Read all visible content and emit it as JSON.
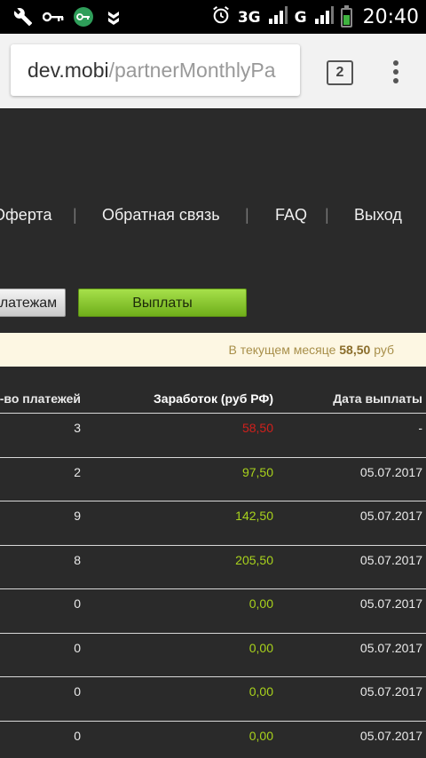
{
  "status_bar": {
    "icons_left": [
      "wrench-icon",
      "key-icon",
      "vpn-key-icon",
      "double-chevron-icon"
    ],
    "network_1": "3G",
    "network_2": "G",
    "time": "20:40"
  },
  "browser": {
    "url_host": "dev.mobi",
    "url_path": "/partnerMonthlyPa",
    "tab_count": "2"
  },
  "nav": {
    "items": [
      "Оферта",
      "Обратная связь",
      "FAQ",
      "Выход"
    ],
    "separator": "|"
  },
  "buttons": {
    "payments": "латежам",
    "payouts": "Выплаты"
  },
  "summary": {
    "prefix": "В текущем месяце",
    "amount": "58,50",
    "suffix": "руб"
  },
  "table": {
    "headers": [
      "-во платежей",
      "Заработок (руб РФ)",
      "Дата выплаты"
    ],
    "rows": [
      {
        "count": "3",
        "earnings": "58,50",
        "date": "-",
        "status": "current"
      },
      {
        "count": "2",
        "earnings": "97,50",
        "date": "05.07.2017",
        "status": "paid"
      },
      {
        "count": "9",
        "earnings": "142,50",
        "date": "05.07.2017",
        "status": "paid"
      },
      {
        "count": "8",
        "earnings": "205,50",
        "date": "05.07.2017",
        "status": "paid"
      },
      {
        "count": "0",
        "earnings": "0,00",
        "date": "05.07.2017",
        "status": "paid"
      },
      {
        "count": "0",
        "earnings": "0,00",
        "date": "05.07.2017",
        "status": "paid"
      },
      {
        "count": "0",
        "earnings": "0,00",
        "date": "05.07.2017",
        "status": "paid"
      },
      {
        "count": "0",
        "earnings": "0,00",
        "date": "05.07.2017",
        "status": "paid"
      }
    ]
  },
  "colors": {
    "current": "#d0201c",
    "paid": "#a8d21c",
    "accent": "#8bc832"
  }
}
